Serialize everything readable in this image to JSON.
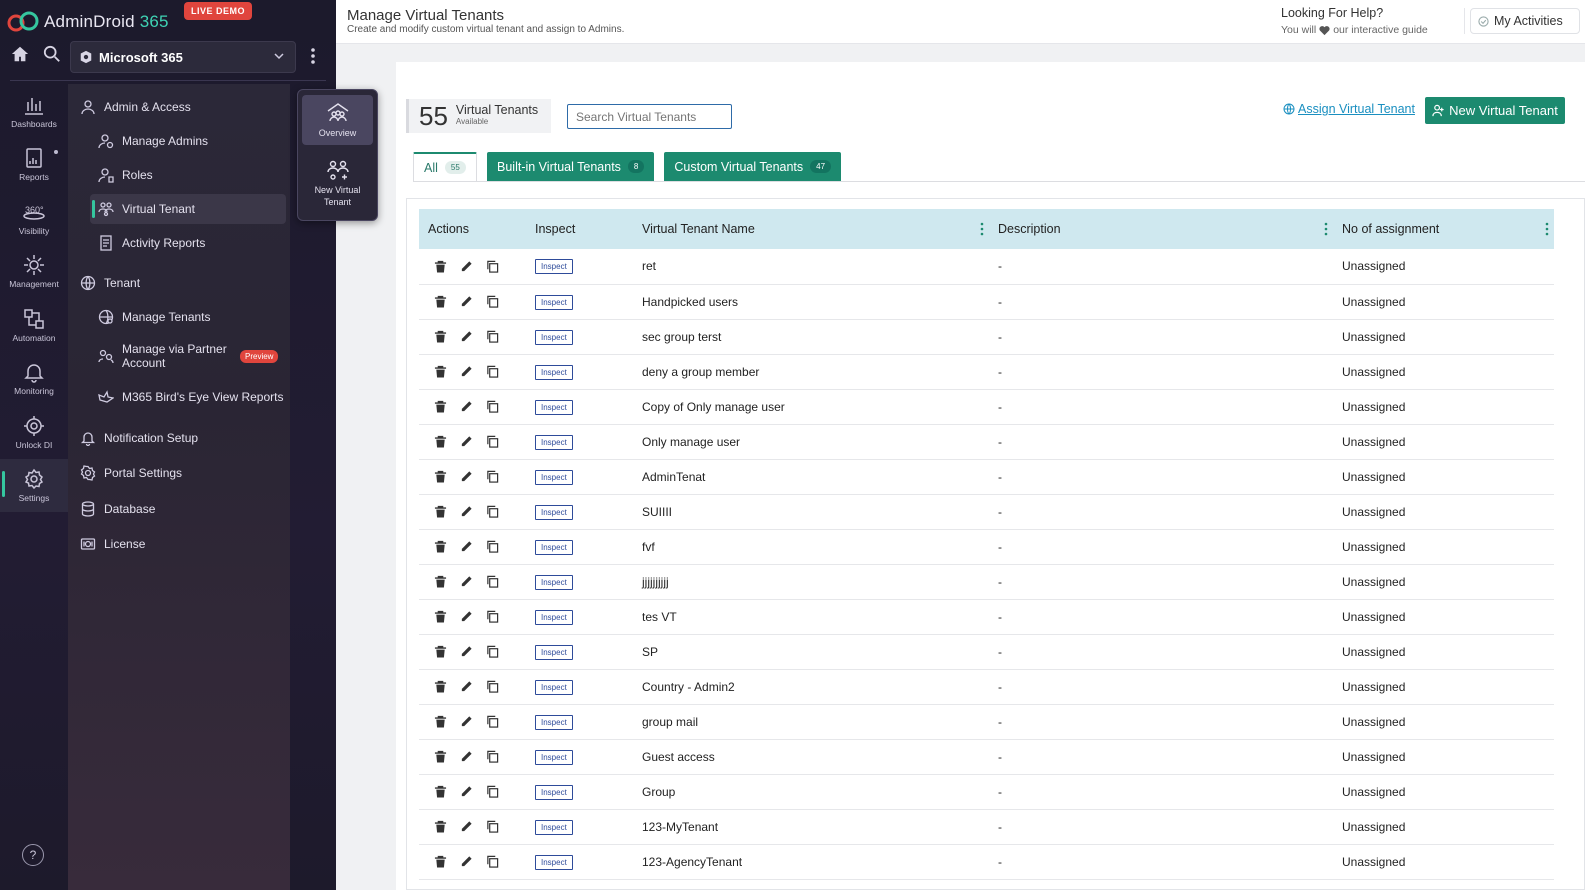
{
  "app": {
    "brand_main": "AdminDroid",
    "brand_accent": "365",
    "live_demo": "LIVE DEMO",
    "tenant_select": "Microsoft 365"
  },
  "rail": [
    {
      "label": "Dashboards",
      "icon": "dashboard-icon"
    },
    {
      "label": "Reports",
      "icon": "reports-icon"
    },
    {
      "label": "Visibility",
      "icon": "360-visibility-icon"
    },
    {
      "label": "Management",
      "icon": "management-icon"
    },
    {
      "label": "Automation",
      "icon": "automation-icon"
    },
    {
      "label": "Monitoring",
      "icon": "monitoring-icon"
    },
    {
      "label": "Unlock DI",
      "icon": "unlock-di-icon"
    },
    {
      "label": "Settings",
      "icon": "settings-icon"
    }
  ],
  "submenu": {
    "admin_access": "Admin & Access",
    "manage_admins": "Manage Admins",
    "roles": "Roles",
    "virtual_tenant": "Virtual Tenant",
    "activity_reports": "Activity Reports",
    "tenant": "Tenant",
    "manage_tenants": "Manage Tenants",
    "manage_partner": "Manage via Partner Account",
    "preview": "Preview",
    "birds_eye": "M365 Bird's Eye View Reports",
    "notification_setup": "Notification Setup",
    "portal_settings": "Portal Settings",
    "database": "Database",
    "license": "License"
  },
  "float_card": {
    "overview": "Overview",
    "new_virtual_tenant": "New Virtual Tenant"
  },
  "header": {
    "title": "Manage Virtual Tenants",
    "subtitle": "Create and modify custom virtual tenant and assign to Admins.",
    "help_title": "Looking For Help?",
    "help_sub_a": "You will",
    "help_sub_b": "our interactive guide",
    "my_activities": "My Activities"
  },
  "toolbar": {
    "count": "55",
    "count_label": "Virtual Tenants",
    "count_sub": "Available",
    "search_placeholder": "Search Virtual Tenants",
    "assign_link": "Assign Virtual Tenant",
    "new_button": "New Virtual Tenant"
  },
  "tabs": [
    {
      "label": "All",
      "count": "55"
    },
    {
      "label": "Built-in Virtual Tenants",
      "count": "8"
    },
    {
      "label": "Custom Virtual Tenants",
      "count": "47"
    }
  ],
  "table": {
    "columns": [
      "Actions",
      "Inspect",
      "Virtual Tenant Name",
      "Description",
      "No of assignment"
    ],
    "inspect_label": "Inspect",
    "rows": [
      {
        "name": "ret",
        "description": "-",
        "assignment": "Unassigned"
      },
      {
        "name": "Handpicked users",
        "description": "-",
        "assignment": "Unassigned"
      },
      {
        "name": "sec group terst",
        "description": "-",
        "assignment": "Unassigned"
      },
      {
        "name": "deny a group member",
        "description": "-",
        "assignment": "Unassigned"
      },
      {
        "name": "Copy of Only manage user",
        "description": "-",
        "assignment": "Unassigned"
      },
      {
        "name": "Only manage user",
        "description": "-",
        "assignment": "Unassigned"
      },
      {
        "name": "AdminTenat",
        "description": "-",
        "assignment": "Unassigned"
      },
      {
        "name": "SUIIII",
        "description": "-",
        "assignment": "Unassigned"
      },
      {
        "name": "fvf",
        "description": "-",
        "assignment": "Unassigned"
      },
      {
        "name": "jjjjjjjjjj",
        "description": "-",
        "assignment": "Unassigned"
      },
      {
        "name": "tes VT",
        "description": "-",
        "assignment": "Unassigned"
      },
      {
        "name": "SP",
        "description": "-",
        "assignment": "Unassigned"
      },
      {
        "name": "Country - Admin2",
        "description": "-",
        "assignment": "Unassigned"
      },
      {
        "name": "group mail",
        "description": "-",
        "assignment": "Unassigned"
      },
      {
        "name": "Guest access",
        "description": "-",
        "assignment": "Unassigned"
      },
      {
        "name": "Group",
        "description": "-",
        "assignment": "Unassigned"
      },
      {
        "name": "123-MyTenant",
        "description": "-",
        "assignment": "Unassigned"
      },
      {
        "name": "123-AgencyTenant",
        "description": "-",
        "assignment": "Unassigned"
      }
    ]
  },
  "colors": {
    "accent": "#1c8a6f",
    "live_demo": "#e0453d",
    "header_row": "#cfe8ef"
  }
}
